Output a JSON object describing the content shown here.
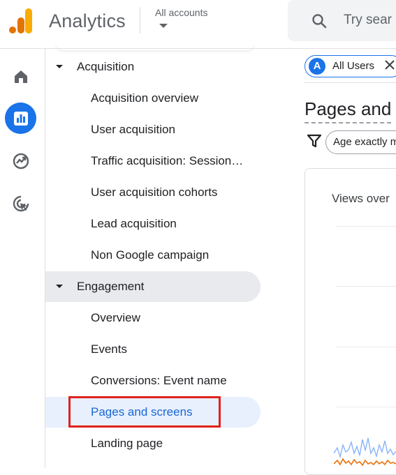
{
  "header": {
    "app_title": "Analytics",
    "accounts_label": "All accounts",
    "search_placeholder": "Try sear"
  },
  "rail": {
    "items": [
      {
        "name": "home-icon",
        "active": false
      },
      {
        "name": "reports-icon",
        "active": true
      },
      {
        "name": "explore-icon",
        "active": false
      },
      {
        "name": "advertising-icon",
        "active": false
      }
    ]
  },
  "nav": {
    "acquisition": {
      "label": "Acquisition",
      "items": [
        "Acquisition overview",
        "User acquisition",
        "Traffic acquisition: Session…",
        "User acquisition cohorts",
        "Lead acquisition",
        "Non Google campaign"
      ]
    },
    "engagement": {
      "label": "Engagement",
      "items": [
        "Overview",
        "Events",
        "Conversions: Event name",
        "Pages and screens",
        "Landing page"
      ],
      "selected": "Pages and screens"
    }
  },
  "main": {
    "segment_chip": {
      "avatar": "A",
      "label": "All Users"
    },
    "page_title": "Pages and",
    "filter_chip": "Age exactly m",
    "card_title": "Views over"
  },
  "colors": {
    "accent": "#1a73e8",
    "selected_bg": "#e8f0fe",
    "highlight_border": "#e0221b",
    "logo_orange": "#f9ab00",
    "logo_dark_orange": "#e37400"
  }
}
